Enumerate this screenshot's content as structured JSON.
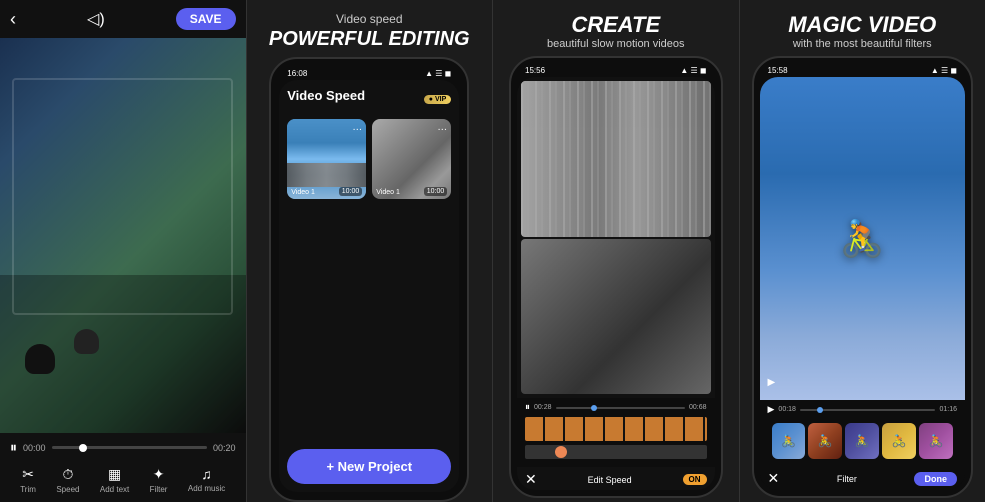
{
  "panels": {
    "panel1": {
      "topbar": {
        "back_label": "‹",
        "sound_label": "◁",
        "save_label": "SAVE"
      },
      "time_start": "00:00",
      "time_end": "00:20",
      "toolbar": {
        "items": [
          {
            "icon": "✂",
            "label": "Trim"
          },
          {
            "icon": "⏱",
            "label": "Speed"
          },
          {
            "icon": "▦",
            "label": "Add text"
          },
          {
            "icon": "✦",
            "label": "Filter"
          },
          {
            "icon": "♫",
            "label": "Add music"
          }
        ]
      }
    },
    "panel2": {
      "subtitle": "Video speed",
      "title": "POWERFUL EDITING",
      "statusbar": {
        "time": "16:08",
        "signal": "●●● ▲"
      },
      "screen": {
        "title": "Video Speed",
        "vip_label": "● VIP",
        "thumbnails": [
          {
            "label": "Video 1",
            "time": "10:00"
          },
          {
            "label": "Video 1",
            "time": "10:00"
          }
        ]
      },
      "new_project_label": "+ New Project"
    },
    "panel3": {
      "title": "CREATE",
      "subtitle": "beautiful slow motion videos",
      "statusbar": {
        "time": "15:56",
        "signal": "●●●"
      },
      "controls": {
        "time_start": "00:28",
        "time_end": "00:68",
        "edit_speed_label": "Edit Speed",
        "on_label": "ON"
      }
    },
    "panel4": {
      "title": "MAGIC VIDEO",
      "subtitle": "with the most beautiful filters",
      "statusbar": {
        "time": "15:58",
        "signal": "●●●"
      },
      "controls": {
        "time_start": "00:18",
        "time_end": "01:16",
        "filter_label": "Filter",
        "done_label": "Done"
      }
    }
  }
}
